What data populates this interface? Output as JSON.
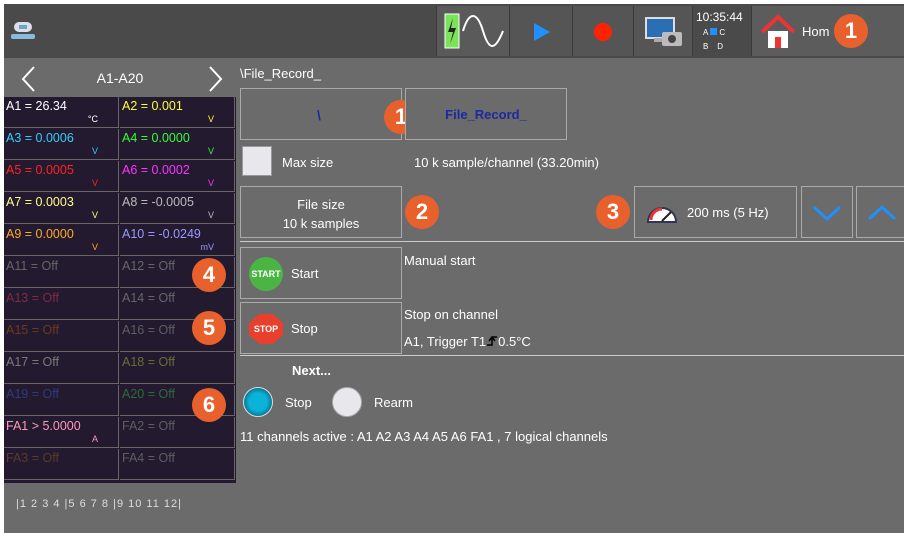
{
  "topbar": {
    "time": "10:35:44",
    "status_top": "A",
    "status_top2": "C",
    "status_bottom": "B",
    "status_bottom2": "D",
    "home_label": "Hom",
    "callout": "1"
  },
  "channels_nav": {
    "label": "A1-A20"
  },
  "channels": [
    {
      "text": "A1 = 26.34",
      "unit": "°C",
      "color": "#ffffff"
    },
    {
      "text": "A2 = 0.001",
      "unit": "V",
      "color": "#ffff33"
    },
    {
      "text": "A3 = 0.0006",
      "unit": "V",
      "color": "#33ccff"
    },
    {
      "text": "A4 = 0.0000",
      "unit": "V",
      "color": "#33ff33"
    },
    {
      "text": "A5 = 0.0005",
      "unit": "V",
      "color": "#ff2222"
    },
    {
      "text": "A6 = 0.0002",
      "unit": "V",
      "color": "#ff33ff"
    },
    {
      "text": "A7 = 0.0003",
      "unit": "V",
      "color": "#ffff88"
    },
    {
      "text": "A8 = -0.0005",
      "unit": "V",
      "color": "#bbbbbb"
    },
    {
      "text": "A9 = 0.0000",
      "unit": "V",
      "color": "#ffaa22"
    },
    {
      "text": "A10 = -0.0249",
      "unit": "mV",
      "color": "#9999ff"
    },
    {
      "text": "A11 = Off",
      "unit": "",
      "color": "#666666"
    },
    {
      "text": "A12 = Off",
      "unit": "",
      "color": "#666666"
    },
    {
      "text": "A13 = Off",
      "unit": "",
      "color": "#7a2d45"
    },
    {
      "text": "A14 = Off",
      "unit": "",
      "color": "#666666"
    },
    {
      "text": "A15 = Off",
      "unit": "",
      "color": "#6b3a1e"
    },
    {
      "text": "A16 = Off",
      "unit": "",
      "color": "#5e5e5e"
    },
    {
      "text": "A17 = Off",
      "unit": "",
      "color": "#7a7a7a"
    },
    {
      "text": "A18 = Off",
      "unit": "",
      "color": "#6b6b3a"
    },
    {
      "text": "A19 = Off",
      "unit": "",
      "color": "#2d3c7a"
    },
    {
      "text": "A20 = Off",
      "unit": "",
      "color": "#2d6b3a"
    },
    {
      "text": "FA1 > 5.0000",
      "unit": "A",
      "color": "#ff99bb"
    },
    {
      "text": "FA2 = Off",
      "unit": "",
      "color": "#5e5e5e"
    },
    {
      "text": "FA3 = Off",
      "unit": "",
      "color": "#5a3a2a"
    },
    {
      "text": "FA4 = Off",
      "unit": "",
      "color": "#5e5e5e"
    }
  ],
  "pages": "|1 2 3 4 |5 6 7 8 |9 10 11 12|",
  "path": "\\File_Record_",
  "folder_button": "\\",
  "file_button": "File_Record_",
  "max_size_label": "Max size",
  "sample_info": "10 k sample/channel  (33.20min)",
  "file_size": {
    "line1": "File size",
    "line2": "10 k samples"
  },
  "sampling": {
    "label": "200 ms (5 Hz)"
  },
  "start": {
    "icon_text": "START",
    "label": "Start",
    "mode": "Manual start"
  },
  "stop": {
    "icon_text": "STOP",
    "label": "Stop",
    "mode": "Stop on channel",
    "detail_a": "A1, Trigger T1",
    "detail_b": "0.5°C"
  },
  "next": {
    "label": "Next...",
    "opt_stop": "Stop",
    "opt_rearm": "Rearm"
  },
  "active_info": "11 channels active : A1 A2 A3 A4 A5 A6 FA1 , 7 logical channels",
  "callouts": {
    "c1": "1",
    "c2": "2",
    "c3": "3",
    "c4": "4",
    "c5": "5",
    "c6": "6"
  },
  "colors": {
    "accent_blue": "#1e90ff",
    "callout": "#e8612c",
    "record_red": "#ff2200"
  }
}
